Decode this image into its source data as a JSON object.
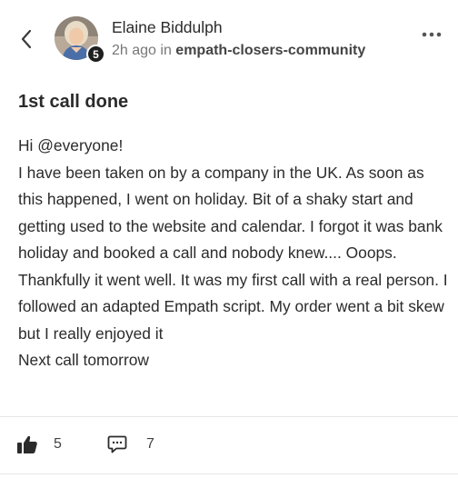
{
  "author": {
    "name": "Elaine Biddulph",
    "level": "5"
  },
  "meta": {
    "time": "2h ago",
    "in_word": "in",
    "group": "empath-closers-community"
  },
  "post": {
    "title": "1st call done",
    "greeting": "Hi @everyone!",
    "body": "I have been taken on by a company in the UK. As soon as this happened, I went on holiday. Bit of a shaky start and getting used to the website and calendar. I forgot it was bank holiday and booked a call and nobody knew.... Ooops. Thankfully it went well. It was my first call with a real person. I followed an adapted Empath script. My order went a bit skew but I really enjoyed it",
    "closing": "Next call tomorrow"
  },
  "stats": {
    "likes": "5",
    "comments": "7"
  },
  "icons": {
    "back": "chevron-left-icon",
    "more": "more-horizontal-icon",
    "like": "thumbs-up-icon",
    "comment": "comment-icon"
  },
  "colors": {
    "text": "#2b2b2b",
    "muted": "#777777",
    "badge": "#1f1f1f"
  }
}
